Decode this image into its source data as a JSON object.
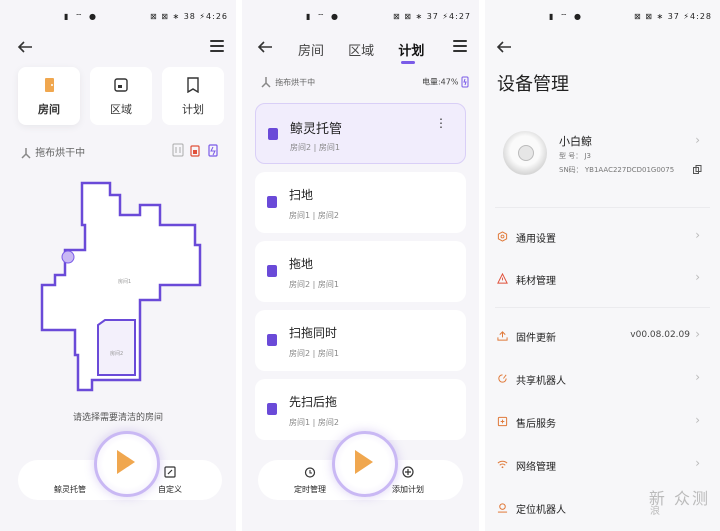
{
  "panel1": {
    "status": {
      "left": "▮ ⌔ ●",
      "right": "⊠ ⊠ ∗ 38 ⚡4:26"
    },
    "modes": [
      {
        "label": "房间",
        "icon": "door-icon"
      },
      {
        "label": "区域",
        "icon": "area-icon"
      },
      {
        "label": "计划",
        "icon": "bookmark-icon"
      }
    ],
    "status_text": "拖布烘干中",
    "hint": "请选择需要清洁的房间",
    "map_labels": [
      "房间1",
      "房间2"
    ],
    "bottom": {
      "left_label": "鲸灵托管",
      "right_label": "自定义"
    }
  },
  "panel2": {
    "status": {
      "left": "▮ ⌔ ●",
      "right": "⊠ ⊠ ∗ 37 ⚡4:27"
    },
    "tabs": [
      "房间",
      "区域",
      "计划"
    ],
    "status_text": "拖布烘干中",
    "battery": "电量:47%",
    "plans": [
      {
        "title": "鲸灵托管",
        "sub": "房间2 | 房间1"
      },
      {
        "title": "扫地",
        "sub": "房间1 | 房间2"
      },
      {
        "title": "拖地",
        "sub": "房间2 | 房间1"
      },
      {
        "title": "扫拖同时",
        "sub": "房间2 | 房间1"
      },
      {
        "title": "先扫后拖",
        "sub": "房间1 | 房间2"
      }
    ],
    "bottom": {
      "left_label": "定时管理",
      "right_label": "添加计划"
    }
  },
  "panel3": {
    "status": {
      "left": "▮ ⌔ ●",
      "right": "⊠ ⊠ ∗ 37 ⚡4:28"
    },
    "title": "设备管理",
    "device": {
      "name": "小白鲸",
      "model": "型 号： J3",
      "sn": "SN码： YB1AAC227DCD01G0075"
    },
    "rows": [
      {
        "label": "通用设置",
        "value": "",
        "icon": "hexagon-settings-icon"
      },
      {
        "label": "耗材管理",
        "value": "",
        "icon": "warning-icon"
      },
      {
        "label": "固件更新",
        "value": "v00.08.02.09",
        "icon": "upload-icon"
      },
      {
        "label": "共享机器人",
        "value": "",
        "icon": "share-icon"
      },
      {
        "label": "售后服务",
        "value": "",
        "icon": "service-icon"
      },
      {
        "label": "网络管理",
        "value": "",
        "icon": "wifi-icon"
      },
      {
        "label": "定位机器人",
        "value": "",
        "icon": "locate-icon"
      }
    ],
    "watermark": "新 众测",
    "watermark2": "浪"
  },
  "colors": {
    "accent": "#7a5be8",
    "orange": "#f0a74f",
    "red": "#e0503a"
  }
}
